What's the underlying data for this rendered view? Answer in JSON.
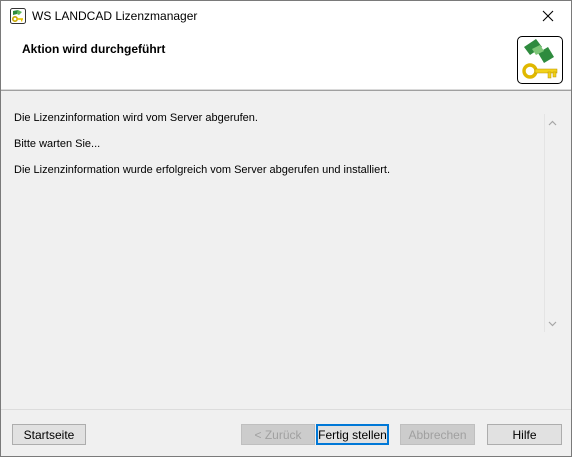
{
  "window": {
    "title": "WS LANDCAD Lizenzmanager"
  },
  "header": {
    "title": "Aktion wird durchgeführt"
  },
  "log": {
    "lines": [
      "Die Lizenzinformation wird vom Server abgerufen.",
      "Bitte warten Sie...",
      "Die Lizenzinformation wurde erfolgreich vom Server abgerufen und installiert."
    ]
  },
  "buttons": {
    "start": "Startseite",
    "back": "< Zurück",
    "finish": "Fertig stellen",
    "cancel": "Abbrechen",
    "help": "Hilfe"
  },
  "colors": {
    "logo_green": "#2e8b3e",
    "key_yellow": "#f2d21a",
    "focus_blue": "#0078d7"
  }
}
